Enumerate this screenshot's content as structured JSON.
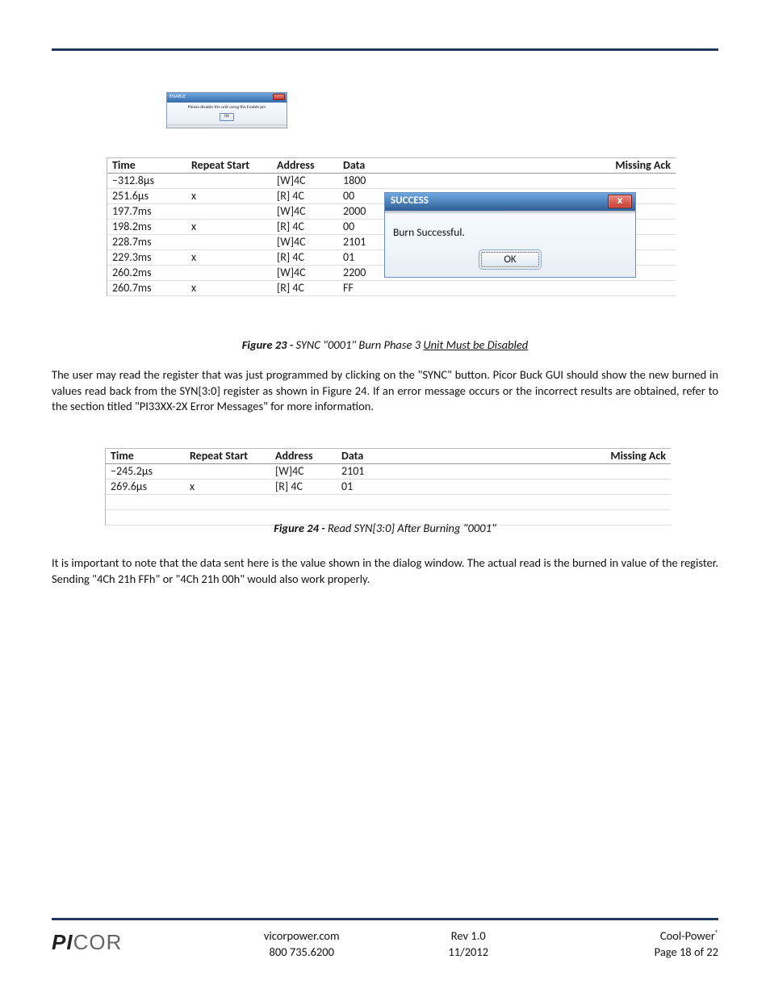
{
  "enable_dialog": {
    "title": "ENABLE",
    "message": "Please disable the unit using the Enable pin",
    "ok_label": "OK"
  },
  "trace1": {
    "headers": {
      "time": "Time",
      "repeat": "Repeat Start",
      "address": "Address",
      "data": "Data",
      "missing": "Missing Ack"
    },
    "rows": [
      {
        "time": "−312.8µs",
        "repeat": "",
        "address": "[W]4C",
        "data": "1800"
      },
      {
        "time": "251.6µs",
        "repeat": "x",
        "address": "[R] 4C",
        "data": "00"
      },
      {
        "time": "197.7ms",
        "repeat": "",
        "address": "[W]4C",
        "data": "2000"
      },
      {
        "time": "198.2ms",
        "repeat": "x",
        "address": "[R] 4C",
        "data": "00"
      },
      {
        "time": "228.7ms",
        "repeat": "",
        "address": "[W]4C",
        "data": "2101"
      },
      {
        "time": "229.3ms",
        "repeat": "x",
        "address": "[R] 4C",
        "data": "01"
      },
      {
        "time": "260.2ms",
        "repeat": "",
        "address": "[W]4C",
        "data": "2200"
      },
      {
        "time": "260.7ms",
        "repeat": "x",
        "address": "[R] 4C",
        "data": "FF"
      }
    ]
  },
  "success_dialog": {
    "title": "SUCCESS",
    "message": "Burn Successful.",
    "ok_label": "OK"
  },
  "caption1": {
    "label": "Figure 23 - ",
    "italic": "SYNC \"0001\" Burn Phase 3 ",
    "underline": "Unit Must be Disabled"
  },
  "paragraph1": "The user may read the register that was just programmed by clicking on the \"SYNC\" button. Picor Buck GUI should show the new burned in values read back from the SYN[3:0] register as shown in Figure 24. If an error message occurs or the incorrect results are obtained, refer to the section titled \"PI33XX-2X Error Messages\" for  more information.",
  "trace2": {
    "headers": {
      "time": "Time",
      "repeat": "Repeat Start",
      "address": "Address",
      "data": "Data",
      "missing": "Missing Ack"
    },
    "rows": [
      {
        "time": "−245.2µs",
        "repeat": "",
        "address": "[W]4C",
        "data": "2101"
      },
      {
        "time": "269.6µs",
        "repeat": "x",
        "address": "[R] 4C",
        "data": "01"
      }
    ]
  },
  "caption2": {
    "label": "Figure 24 - ",
    "italic": "Read SYN[3:0] After Burning \"0001\""
  },
  "paragraph2": "It is important to note that the data sent here is the value shown in the dialog window. The actual read is the burned in value of the register. Sending \"4Ch 21h FFh\" or \"4Ch 21h 00h\" would also work properly.",
  "footer": {
    "brand1": "PI",
    "brand2": "COR",
    "url": "vicorpower.com",
    "phone": "800 735.6200",
    "rev": "Rev 1.0",
    "date": "11/2012",
    "product": "Cool-Power",
    "reg": "®",
    "page": "Page 18 of 22"
  }
}
